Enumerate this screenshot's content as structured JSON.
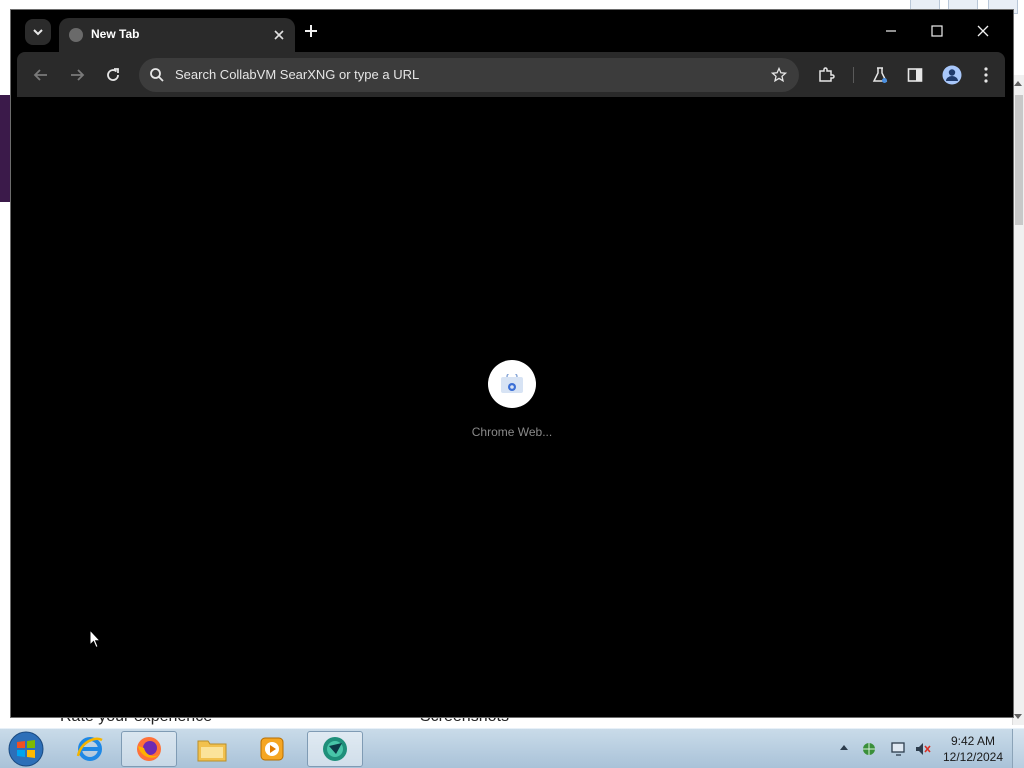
{
  "browser": {
    "tab": {
      "title": "New Tab"
    },
    "omnibox": {
      "placeholder": "Search CollabVM SearXNG or type a URL"
    },
    "content": {
      "loading_label": "Chrome Web..."
    }
  },
  "background_page": {
    "left_heading": "Rate your experience",
    "right_heading": "Screenshots"
  },
  "taskbar": {
    "apps": [
      "internet-explorer",
      "firefox",
      "windows-explorer",
      "media-player",
      "chrome-web-app"
    ],
    "clock": {
      "time": "9:42 AM",
      "date": "12/12/2024"
    }
  },
  "colors": {
    "chrome_frame": "#000000",
    "toolbar": "#2a2a2a",
    "omnibox": "#3c3c3c",
    "taskbar": "#b9cfe2"
  },
  "icons": {
    "tab_search": "chevron-down-icon",
    "new_tab": "plus-icon",
    "back": "arrow-left-icon",
    "forward": "arrow-right-icon",
    "reload": "reload-icon",
    "search": "search-icon",
    "bookmark": "star-icon",
    "extensions": "puzzle-icon",
    "labs": "flask-icon",
    "side_panel": "side-panel-icon",
    "profile": "profile-icon",
    "menu": "kebab-menu-icon"
  }
}
